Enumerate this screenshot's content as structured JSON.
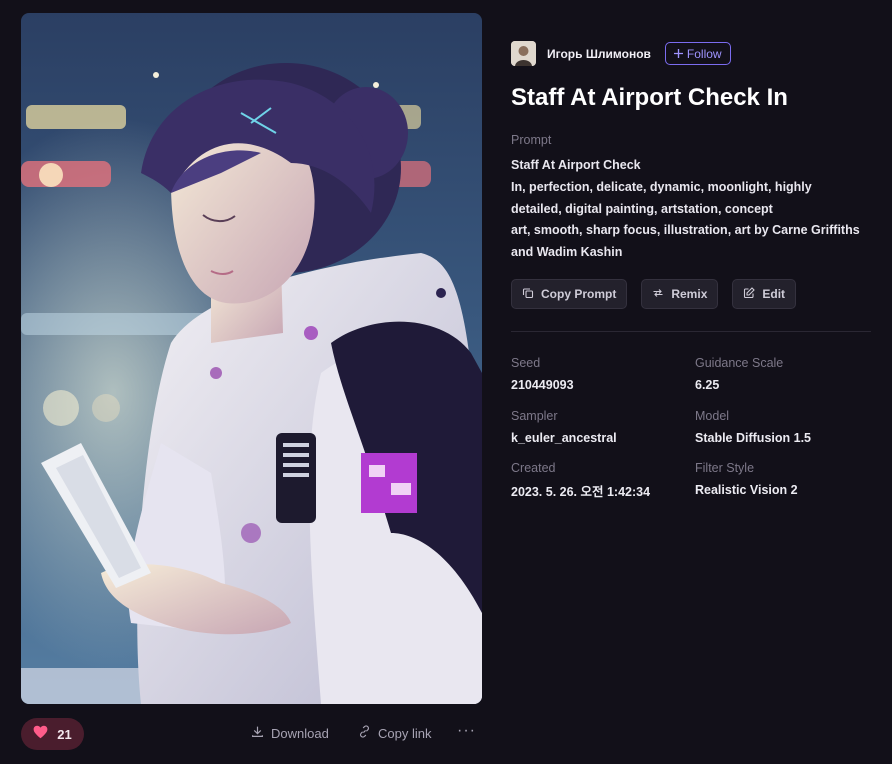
{
  "author": {
    "name": "Игорь Шлимонов",
    "follow_label": "Follow"
  },
  "title": "Staff At Airport Check In",
  "prompt": {
    "label": "Prompt",
    "lines": [
      "Staff At Airport Check",
      "In, perfection, delicate, dynamic, moonlight, highly",
      "detailed, digital painting, artstation, concept",
      "art, smooth, sharp focus, illustration, art by Carne Griffiths",
      "and Wadim Kashin"
    ]
  },
  "buttons": {
    "copy_prompt": "Copy Prompt",
    "remix": "Remix",
    "edit": "Edit"
  },
  "meta": {
    "seed": {
      "label": "Seed",
      "value": "210449093"
    },
    "guidance": {
      "label": "Guidance Scale",
      "value": "6.25"
    },
    "sampler": {
      "label": "Sampler",
      "value": "k_euler_ancestral"
    },
    "model": {
      "label": "Model",
      "value": "Stable Diffusion 1.5"
    },
    "created": {
      "label": "Created",
      "value": "2023. 5. 26. 오전 1:42:34"
    },
    "filter": {
      "label": "Filter Style",
      "value": "Realistic Vision 2"
    }
  },
  "actions": {
    "likes": "21",
    "download": "Download",
    "copy_link": "Copy link",
    "more": "···"
  },
  "colors": {
    "background": "#121019",
    "accent": "#7b6cf0",
    "like_bg": "#4a1d2d",
    "like_heart": "#ff5c8a"
  },
  "icons": [
    "heart-icon",
    "download-icon",
    "link-icon",
    "more-icon",
    "plus-icon",
    "copy-icon",
    "remix-icon",
    "edit-icon"
  ]
}
